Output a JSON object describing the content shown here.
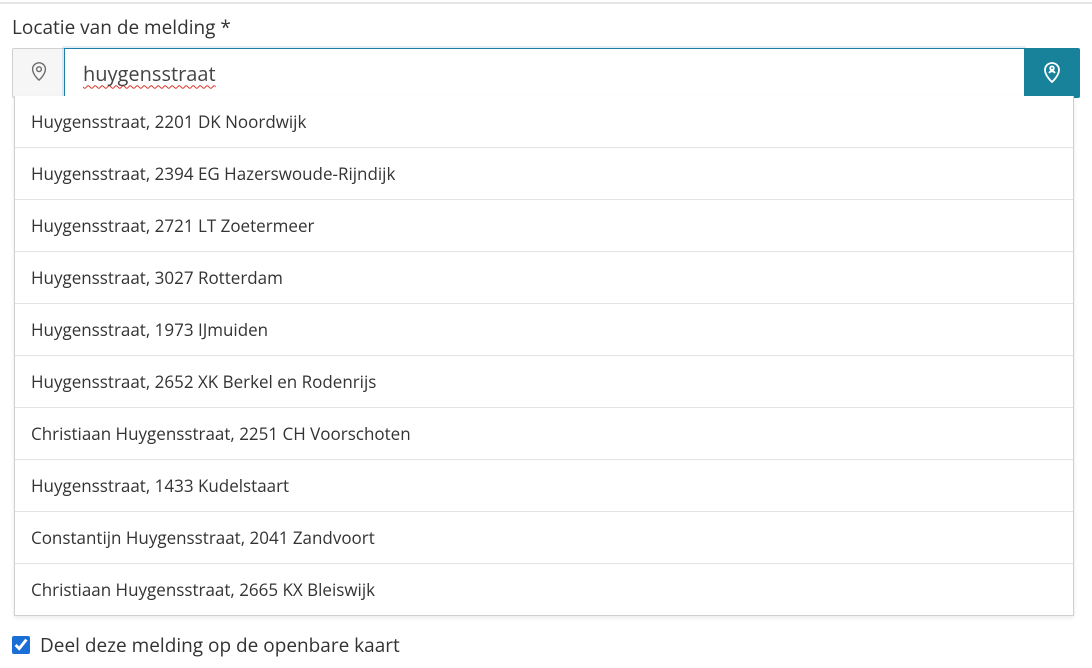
{
  "location": {
    "label": "Locatie van de melding *",
    "input_value": "huygensstraat",
    "suggestions": [
      "Huygensstraat, 2201 DK Noordwijk",
      "Huygensstraat, 2394 EG Hazerswoude-Rijndijk",
      "Huygensstraat, 2721 LT Zoetermeer",
      "Huygensstraat, 3027 Rotterdam",
      "Huygensstraat, 1973 IJmuiden",
      "Huygensstraat, 2652 XK Berkel en Rodenrijs",
      "Christiaan Huygensstraat, 2251 CH Voorschoten",
      "Huygensstraat, 1433 Kudelstaart",
      "Constantijn Huygensstraat, 2041 Zandvoort",
      "Christiaan Huygensstraat, 2665 KX Bleiswijk"
    ]
  },
  "share": {
    "label": "Deel deze melding op de openbare kaart",
    "checked": true
  }
}
